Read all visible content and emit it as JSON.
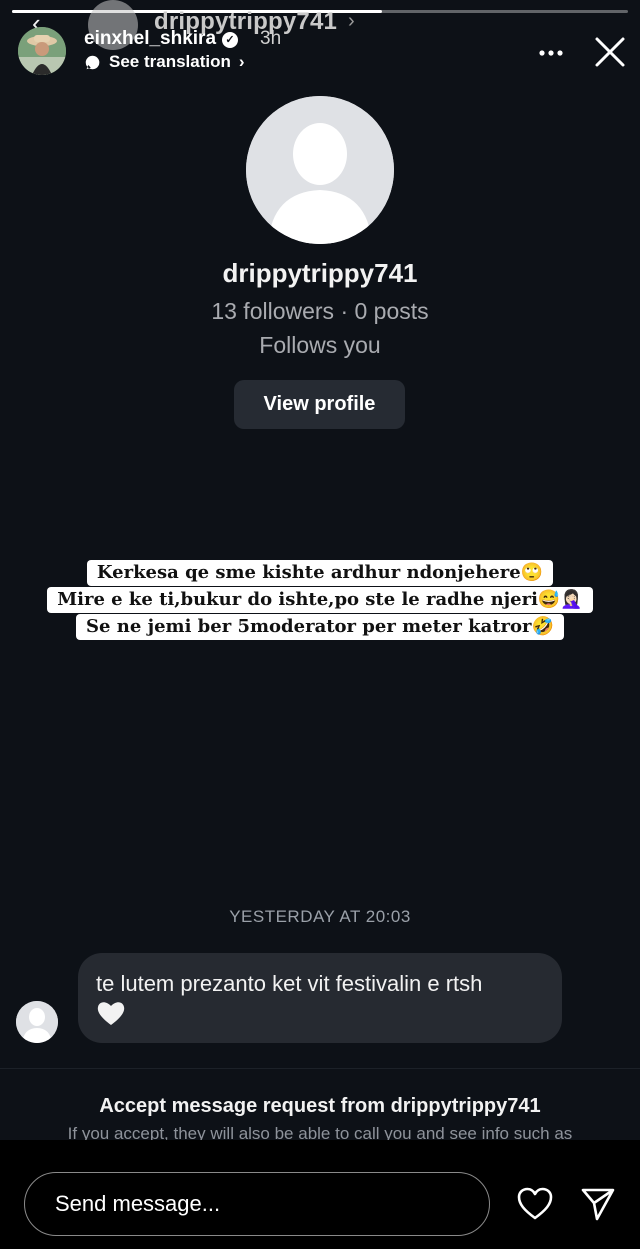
{
  "story": {
    "progress_fraction": 0.6,
    "author": {
      "username": "einxhel_shkira",
      "time": "3h",
      "translation_label": "See translation"
    },
    "underlying_header": {
      "username": "drippytrippy741"
    }
  },
  "profile_card": {
    "username": "drippytrippy741",
    "stats": "13 followers · 0 posts",
    "relationship": "Follows you",
    "view_profile_label": "View profile"
  },
  "caption": {
    "line1": "Kerkesa qe sme kishte ardhur ndonjehere🙄",
    "line2": "Mire e ke ti,bukur do ishte,po ste le radhe njeri😅🤦🏻‍♀️",
    "line3": "Se ne jemi ber 5moderator per meter katror🤣"
  },
  "conversation": {
    "date_label": "YESTERDAY AT 20:03",
    "message_text": "te lutem prezanto ket vit festivalin e rtsh"
  },
  "request": {
    "title": "Accept message request from drippytrippy741",
    "subtitle": "If you accept, they will also be able to call you and see info such as"
  },
  "reply": {
    "placeholder": "Send message..."
  },
  "icons": {
    "back": "back-chevron-icon",
    "verified": "verified-badge-icon",
    "translate": "speech-bubble-icon",
    "more": "more-dots-icon",
    "close": "close-icon",
    "like": "heart-icon",
    "send": "paper-plane-icon",
    "message_emoji": "white-heart-emoji"
  }
}
